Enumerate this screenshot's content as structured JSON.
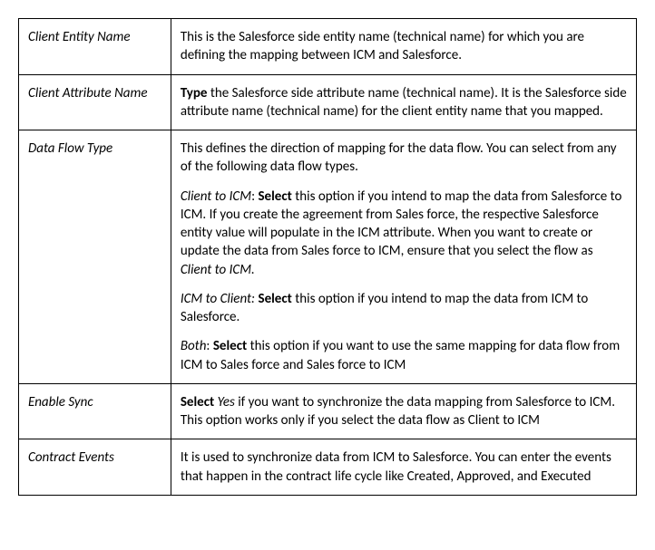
{
  "rows": {
    "r0": {
      "label": "Client Entity Name",
      "p0": {
        "t0": "This is the Salesforce side entity name (technical name) for which you are defining the mapping between ICM and Salesforce."
      }
    },
    "r1": {
      "label": "Client Attribute Name",
      "p0": {
        "t0": "Type",
        "t1": " the Salesforce side attribute name (technical name). It is the Salesforce side attribute name (technical name) for the client entity name that you mapped."
      }
    },
    "r2": {
      "label": "Data Flow Type",
      "p0": {
        "t0": "This defines the direction of mapping for the data flow. You can select from any of the following data flow types."
      },
      "p1": {
        "t0": "Client to ICM",
        "t1": ": ",
        "t2": "Select",
        "t3": " this option if you intend to map the data from Salesforce to ICM. If you create the agreement from Sales force, the respective Salesforce entity value will populate in the ICM attribute. When you want to create or update the data from Sales force to ICM, ensure that you select the flow as ",
        "t4": "Client to ICM.",
        "t5": ""
      },
      "p2": {
        "t0": "ICM to Client:",
        "t1": " ",
        "t2": "Select",
        "t3": " this option if you intend to map the data from ICM to Salesforce."
      },
      "p3": {
        "t0": "Both",
        "t1": ": ",
        "t2": "Select",
        "t3": " this option if you want to use the same mapping for data flow from ICM to Sales force and Sales force to ICM"
      }
    },
    "r3": {
      "label": "Enable Sync",
      "p0": {
        "t0": "Select",
        "t1": " ",
        "t2": "Yes",
        "t3": " if you want to synchronize the data mapping from Salesforce to ICM. This option works only if you select the data flow as Client to ICM"
      }
    },
    "r4": {
      "label": "Contract Events",
      "p0": {
        "t0": "It is used to synchronize data from ICM to Salesforce. You can enter the events that happen in the contract life cycle like Created, Approved, and Executed"
      }
    }
  }
}
